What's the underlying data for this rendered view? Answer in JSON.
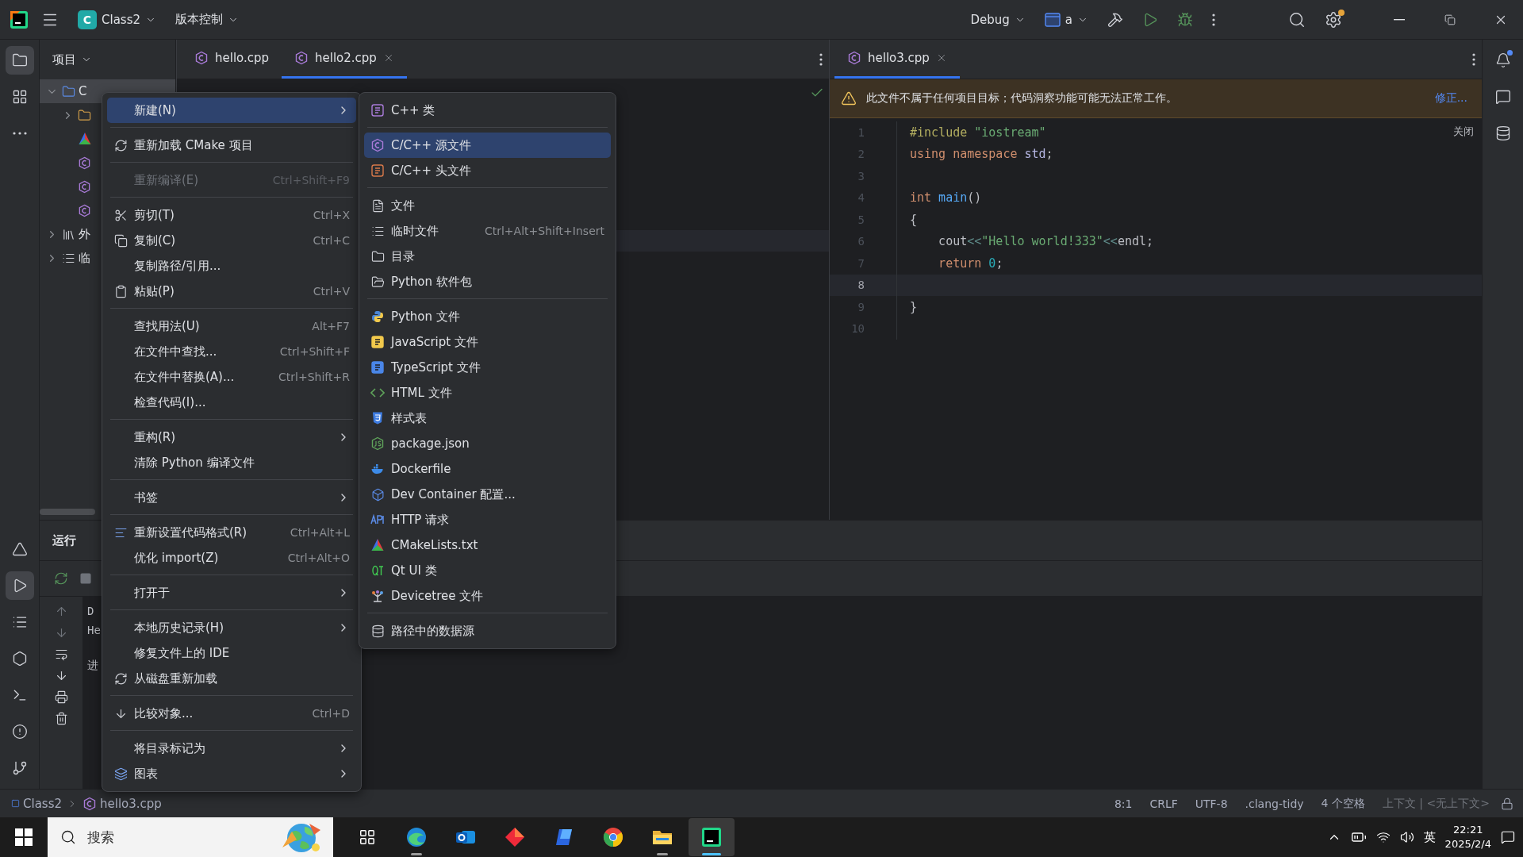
{
  "title_bar": {
    "project_badge": "C",
    "project": "Class2",
    "vcs": "版本控制",
    "run_config": "Debug",
    "target": "a"
  },
  "left_toolbar": {
    "top": [
      {
        "selected": true
      },
      {
        "selected": false
      },
      {
        "selected": false
      }
    ],
    "bottom": [
      {
        "selected": false
      },
      {
        "selected": true
      },
      {
        "selected": false
      },
      {
        "selected": false
      },
      {
        "selected": false
      },
      {
        "selected": false
      },
      {
        "selected": false
      }
    ]
  },
  "project_panel": {
    "title": "项目",
    "tree": [
      {
        "label": "C",
        "kind": "module",
        "expanded": true,
        "selected": true,
        "children": [
          {
            "kind": "folder",
            "expanded": false
          },
          {
            "kind": "cmake"
          },
          {
            "kind": "cpp"
          },
          {
            "kind": "cpp"
          },
          {
            "kind": "cpp"
          }
        ]
      },
      {
        "label": "外",
        "kind": "library",
        "expanded": false,
        "selected": false
      },
      {
        "label": "临",
        "kind": "scratches",
        "expanded": false,
        "selected": false
      }
    ]
  },
  "left_editor": {
    "tabs": [
      {
        "label": "hello.cpp",
        "selected": false
      },
      {
        "label": "hello2.cpp",
        "selected": true
      }
    ]
  },
  "right_editor": {
    "tabs": [
      {
        "label": "hello3.cpp",
        "selected": true
      }
    ],
    "banner": {
      "text": "此文件不属于任何项目目标；代码洞察功能可能无法正常工作。",
      "action": "修正..."
    },
    "close_hint": "关闭",
    "lines": [
      {
        "number": "1",
        "current": false,
        "tokens": [
          {
            "text": "#include",
            "kind": "directive"
          },
          {
            "text": " \"iostream\"",
            "kind": "string"
          }
        ]
      },
      {
        "number": "2",
        "current": false,
        "tokens": [
          {
            "text": "using namespace",
            "kind": "keyword"
          },
          {
            "text": " std",
            "kind": "namespace"
          },
          {
            "text": ";",
            "kind": "plain"
          }
        ]
      },
      {
        "number": "3",
        "current": false
      },
      {
        "number": "4",
        "current": false,
        "tokens": [
          {
            "text": "int",
            "kind": "keyword"
          },
          {
            "text": " main",
            "kind": "function"
          },
          {
            "text": "()",
            "kind": "plain"
          }
        ]
      },
      {
        "number": "5",
        "current": false,
        "tokens": [
          {
            "text": "{",
            "kind": "plain"
          }
        ]
      },
      {
        "number": "6",
        "current": false,
        "tokens": [
          {
            "text": "    cout",
            "kind": "plain"
          },
          {
            "text": "<<",
            "kind": "operator"
          },
          {
            "text": "\"Hello world!333\"",
            "kind": "string"
          },
          {
            "text": "<<",
            "kind": "operator"
          },
          {
            "text": "endl;",
            "kind": "plain"
          }
        ]
      },
      {
        "number": "7",
        "current": false,
        "tokens": [
          {
            "text": "    return",
            "kind": "keyword"
          },
          {
            "text": " 0",
            "kind": "number"
          },
          {
            "text": ";",
            "kind": "plain"
          }
        ]
      },
      {
        "number": "8",
        "current": true
      },
      {
        "number": "9",
        "current": false,
        "tokens": [
          {
            "text": "}",
            "kind": "plain"
          }
        ]
      },
      {
        "number": "10",
        "current": false
      }
    ]
  },
  "run_panel": {
    "title": "运行",
    "console": [
      {
        "text": "D",
        "gap_before": false
      },
      {
        "text": "He",
        "gap_before": false
      },
      {
        "text": "进",
        "gap_before": true
      }
    ]
  },
  "context_menu": {
    "groups": [
      [
        {
          "label": "新建(N)",
          "has_submenu": true,
          "selected": true,
          "disabled": false
        }
      ],
      [
        {
          "label": "重新加载 CMake 项目",
          "has_submenu": false,
          "selected": false,
          "disabled": false
        }
      ],
      [
        {
          "label": "重新编译(E)",
          "shortcut": "Ctrl+Shift+F9",
          "has_submenu": false,
          "selected": false,
          "disabled": true
        }
      ],
      [
        {
          "label": "剪切(T)",
          "shortcut": "Ctrl+X",
          "has_submenu": false,
          "selected": false,
          "disabled": false
        },
        {
          "label": "复制(C)",
          "shortcut": "Ctrl+C",
          "has_submenu": false,
          "selected": false,
          "disabled": false
        },
        {
          "label": "复制路径/引用...",
          "has_submenu": false,
          "selected": false,
          "disabled": false
        },
        {
          "label": "粘贴(P)",
          "shortcut": "Ctrl+V",
          "has_submenu": false,
          "selected": false,
          "disabled": false
        }
      ],
      [
        {
          "label": "查找用法(U)",
          "shortcut": "Alt+F7",
          "has_submenu": false,
          "selected": false,
          "disabled": false
        },
        {
          "label": "在文件中查找...",
          "shortcut": "Ctrl+Shift+F",
          "has_submenu": false,
          "selected": false,
          "disabled": false
        },
        {
          "label": "在文件中替换(A)...",
          "shortcut": "Ctrl+Shift+R",
          "has_submenu": false,
          "selected": false,
          "disabled": false
        },
        {
          "label": "检查代码(I)...",
          "has_submenu": false,
          "selected": false,
          "disabled": false
        }
      ],
      [
        {
          "label": "重构(R)",
          "has_submenu": true,
          "selected": false,
          "disabled": false
        },
        {
          "label": "清除 Python 编译文件",
          "has_submenu": false,
          "selected": false,
          "disabled": false
        }
      ],
      [
        {
          "label": "书签",
          "has_submenu": true,
          "selected": false,
          "disabled": false
        }
      ],
      [
        {
          "label": "重新设置代码格式(R)",
          "shortcut": "Ctrl+Alt+L",
          "has_submenu": false,
          "selected": false,
          "disabled": false
        },
        {
          "label": "优化 import(Z)",
          "shortcut": "Ctrl+Alt+O",
          "has_submenu": false,
          "selected": false,
          "disabled": false
        }
      ],
      [
        {
          "label": "打开于",
          "has_submenu": true,
          "selected": false,
          "disabled": false
        }
      ],
      [
        {
          "label": "本地历史记录(H)",
          "has_submenu": true,
          "selected": false,
          "disabled": false
        },
        {
          "label": "修复文件上的 IDE",
          "has_submenu": false,
          "selected": false,
          "disabled": false
        },
        {
          "label": "从磁盘重新加载",
          "has_submenu": false,
          "selected": false,
          "disabled": false
        }
      ],
      [
        {
          "label": "比较对象...",
          "shortcut": "Ctrl+D",
          "has_submenu": false,
          "selected": false,
          "disabled": false
        }
      ],
      [
        {
          "label": "将目录标记为",
          "has_submenu": true,
          "selected": false,
          "disabled": false
        },
        {
          "label": "图表",
          "has_submenu": true,
          "selected": false,
          "disabled": false
        }
      ]
    ]
  },
  "submenu": {
    "groups": [
      [
        {
          "label": "C++ 类",
          "selected": false
        }
      ],
      [
        {
          "label": "C/C++ 源文件",
          "selected": true
        },
        {
          "label": "C/C++ 头文件",
          "selected": false
        }
      ],
      [
        {
          "label": "文件",
          "selected": false
        },
        {
          "label": "临时文件",
          "shortcut": "Ctrl+Alt+Shift+Insert",
          "selected": false
        },
        {
          "label": "目录",
          "selected": false
        },
        {
          "label": "Python 软件包",
          "selected": false
        }
      ],
      [
        {
          "label": "Python 文件",
          "selected": false
        },
        {
          "label": "JavaScript 文件",
          "selected": false
        },
        {
          "label": "TypeScript 文件",
          "selected": false
        },
        {
          "label": "HTML 文件",
          "selected": false
        },
        {
          "label": "样式表",
          "selected": false
        },
        {
          "label": "package.json",
          "selected": false
        },
        {
          "label": "Dockerfile",
          "selected": false
        },
        {
          "label": "Dev Container 配置...",
          "selected": false
        },
        {
          "label": "HTTP 请求",
          "selected": false
        },
        {
          "label": "CMakeLists.txt",
          "selected": false
        },
        {
          "label": "Qt UI 类",
          "selected": false
        },
        {
          "label": "Devicetree 文件",
          "selected": false
        }
      ],
      [
        {
          "label": "路径中的数据源",
          "selected": false
        }
      ]
    ]
  },
  "status_bar": {
    "breadcrumbs": [
      "Class2",
      "hello3.cpp"
    ],
    "items": [
      "8:1",
      "CRLF",
      "UTF-8",
      ".clang-tidy",
      "4 个空格"
    ],
    "context": "上下文 | <无上下文>"
  },
  "taskbar": {
    "search": {
      "placeholder": "搜索"
    },
    "apps": [
      {
        "running": false,
        "active": false
      },
      {
        "running": true,
        "active": false
      },
      {
        "running": false,
        "active": false
      },
      {
        "running": false,
        "active": false
      },
      {
        "running": false,
        "active": false
      },
      {
        "running": false,
        "active": false
      },
      {
        "running": true,
        "active": false
      },
      {
        "running": true,
        "active": true
      }
    ],
    "ime": "英",
    "time": "22:21",
    "date": "2025/2/4"
  }
}
